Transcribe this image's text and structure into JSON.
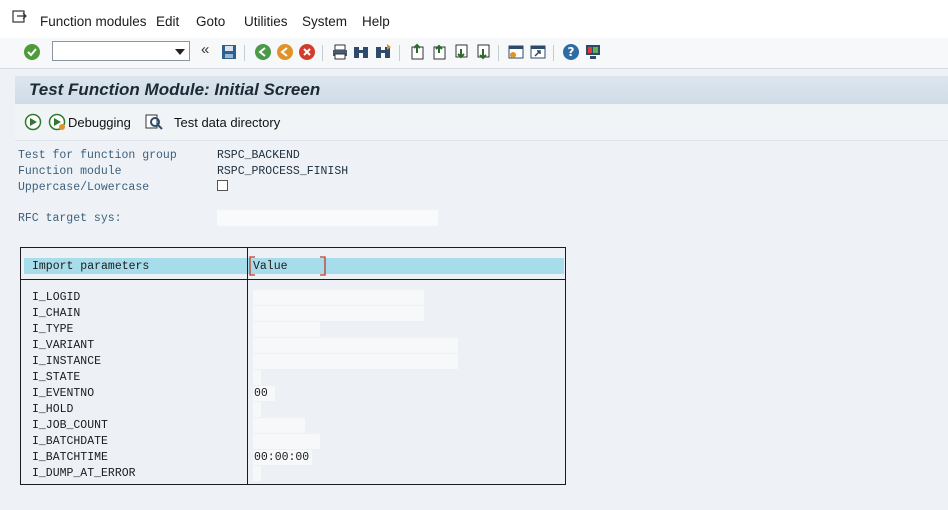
{
  "menu": [
    "Function modules",
    "Edit",
    "Goto",
    "Utilities",
    "System",
    "Help"
  ],
  "toolbar": {
    "command_value": "",
    "icons": [
      "enter-icon",
      "back-arrows-icon",
      "save-icon",
      "back-icon",
      "exit-icon",
      "cancel-icon",
      "print-icon",
      "find-icon",
      "find-next-icon",
      "first-page-icon",
      "previous-page-icon",
      "next-page-icon",
      "last-page-icon",
      "create-session-icon",
      "shortcut-icon",
      "help-icon",
      "layout-icon"
    ]
  },
  "title": "Test Function Module: Initial Screen",
  "app_toolbar": {
    "debugging_label": "Debugging",
    "test_data_label": "Test data directory"
  },
  "fields": {
    "function_group_label": "Test for function group",
    "function_group_value": "RSPC_BACKEND",
    "function_module_label": "Function module",
    "function_module_value": "RSPC_PROCESS_FINISH",
    "case_label": "Uppercase/Lowercase",
    "case_checked": false,
    "rfc_label": "RFC target sys:",
    "rfc_value": ""
  },
  "table": {
    "header_param": "Import parameters",
    "header_value": "Value",
    "rows": [
      {
        "name": "I_LOGID",
        "value": ""
      },
      {
        "name": "I_CHAIN",
        "value": ""
      },
      {
        "name": "I_TYPE",
        "value": ""
      },
      {
        "name": "I_VARIANT",
        "value": ""
      },
      {
        "name": "I_INSTANCE",
        "value": ""
      },
      {
        "name": "I_STATE",
        "value": ""
      },
      {
        "name": "I_EVENTNO",
        "value": "00"
      },
      {
        "name": "I_HOLD",
        "value": ""
      },
      {
        "name": "I_JOB_COUNT",
        "value": ""
      },
      {
        "name": "I_BATCHDATE",
        "value": ""
      },
      {
        "name": "I_BATCHTIME",
        "value": "00:00:00"
      },
      {
        "name": "I_DUMP_AT_ERROR",
        "value": ""
      }
    ]
  },
  "colors": {
    "header_highlight": "#a7dceb",
    "label_blue": "#3d5f7b"
  }
}
